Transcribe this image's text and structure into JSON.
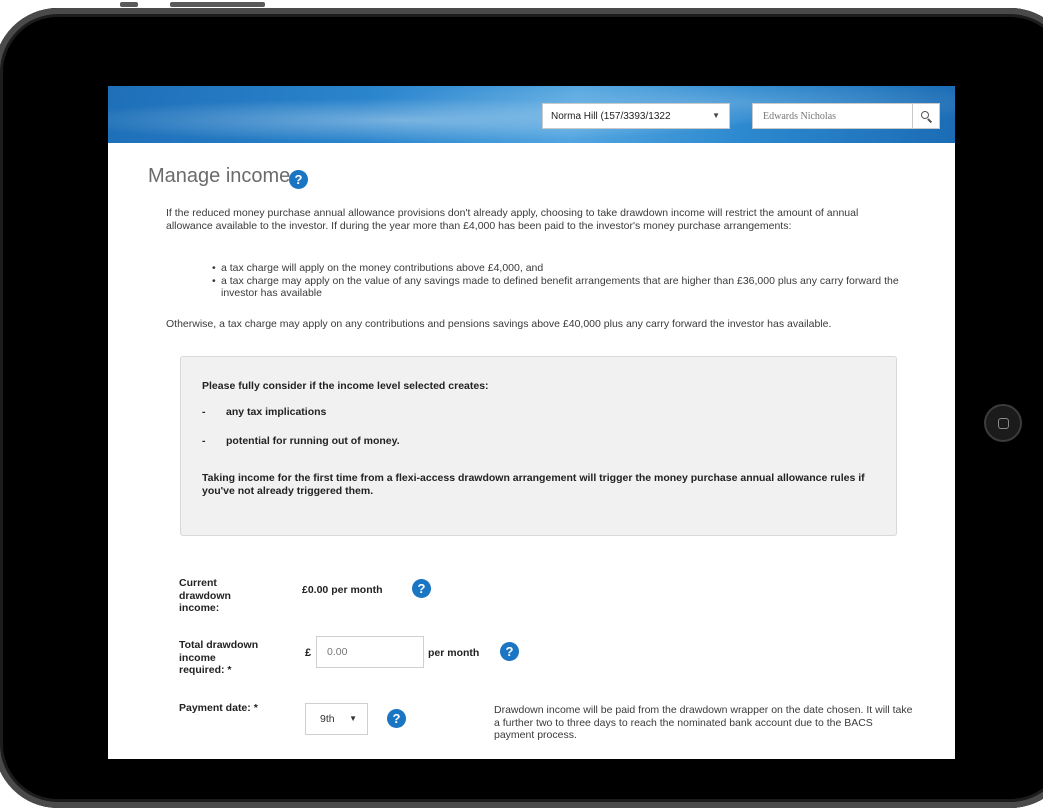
{
  "header": {
    "client_select_value": "Norma Hill (157/3393/1322",
    "search_value": "Edwards Nicholas"
  },
  "page": {
    "title": "Manage income",
    "intro": "If the reduced money purchase annual allowance provisions don't already apply, choosing to take drawdown income will restrict the amount of annual allowance available to the investor. If during the year more than £4,000 has been paid to the investor's money purchase arrangements:",
    "bullets": [
      "a tax charge will apply on the money contributions above £4,000, and",
      "a tax charge may apply on the value of any savings made to defined benefit arrangements that are higher than £36,000 plus any carry forward the investor has available"
    ],
    "otherwise": "Otherwise, a tax charge may apply on any contributions and pensions savings above £40,000 plus any carry forward the investor has available."
  },
  "notice": {
    "heading": "Please fully consider if the income level selected creates:",
    "items": [
      "any tax implications",
      "potential for running out of money."
    ],
    "dash": "-",
    "footer": "Taking income for the first time from a flexi-access drawdown arrangement will trigger the money purchase annual allowance rules if you've not already triggered them."
  },
  "form": {
    "current_label": "Current drawdown income:",
    "current_value": "£0.00 per month",
    "total_label": "Total drawdown income required: *",
    "currency_symbol": "£",
    "amount_value": "0.00",
    "per_month": "per month",
    "payment_date_label": "Payment date: *",
    "payment_date_value": "9th",
    "payment_note": "Drawdown income will be paid from the drawdown wrapper on the date chosen. It will take a further two to three days to reach the nominated bank account due to the BACS payment process."
  },
  "icons": {
    "help": "?",
    "caret": "▼"
  },
  "colors": {
    "accent": "#1a75c2",
    "banner": "#2a84cc",
    "notice_bg": "#f1f1f1"
  }
}
